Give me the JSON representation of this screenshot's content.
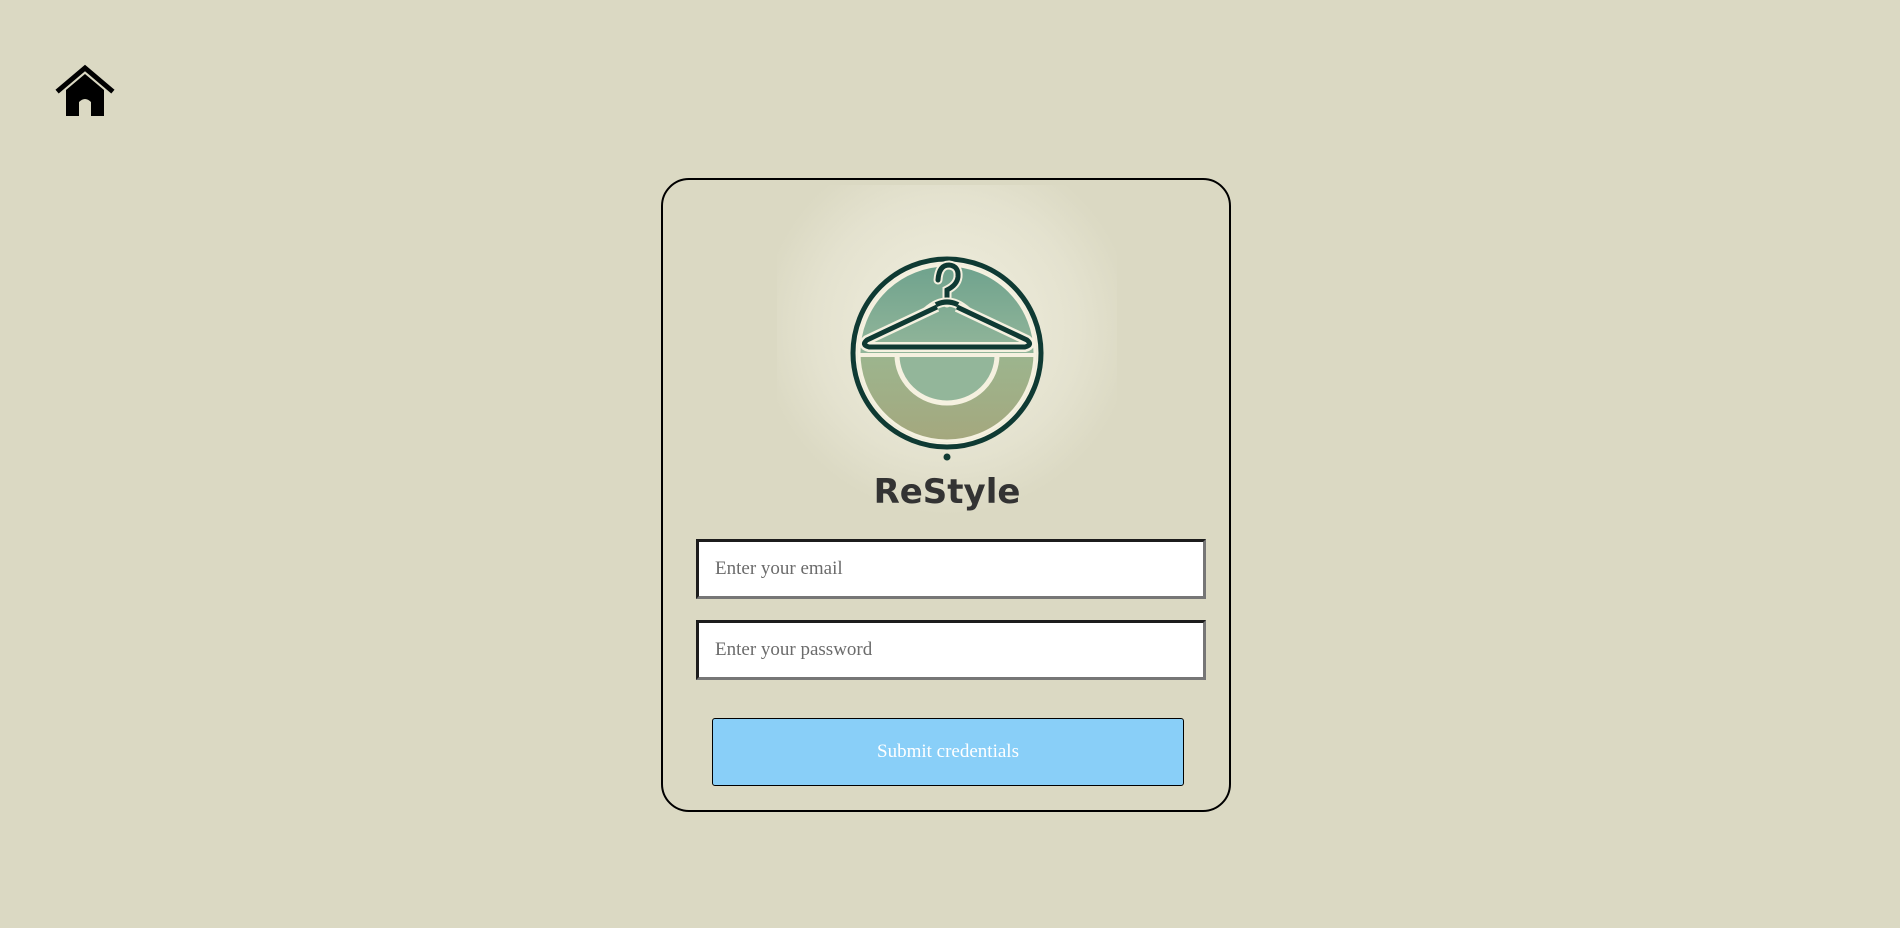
{
  "home": {
    "icon": "home-icon"
  },
  "logo": {
    "brand_name": "ReStyle",
    "icon": "clothes-hanger-icon"
  },
  "form": {
    "email_placeholder": "Enter your email",
    "password_placeholder": "Enter your password",
    "submit_label": "Submit credentials"
  },
  "colors": {
    "background": "#dbd9c3",
    "button": "#89cff8",
    "button_text": "#ffffff",
    "brand_text": "#333333",
    "logo_ring": "#0f3a33"
  }
}
